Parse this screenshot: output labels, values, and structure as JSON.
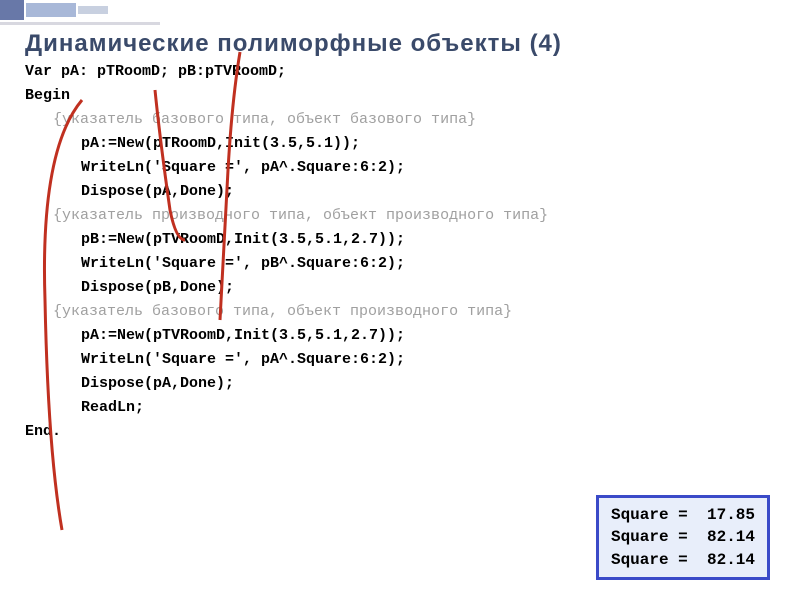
{
  "title": "Динамические полиморфные объекты (4)",
  "code": {
    "l1": "Var pA: pTRoomD; pB:pTVRoomD;",
    "l2": "Begin",
    "c1": "{указатель базового типа, объект базового типа}",
    "l3": "pA:=New(pTRoomD,Init(3.5,5.1));",
    "l4": "WriteLn('Square =', pA^.Square:6:2);",
    "l5": "Dispose(pA,Done);",
    "c2": "{указатель производного типа, объект производного типа}",
    "l6": "pB:=New(pTVRoomD,Init(3.5,5.1,2.7));",
    "l7": "WriteLn('Square =', pB^.Square:6:2);",
    "l8": "Dispose(pB,Done);",
    "c3": "{указатель базового типа, объект производного типа}",
    "l9": "pA:=New(pTVRoomD,Init(3.5,5.1,2.7));",
    "l10": "WriteLn('Square =', pA^.Square:6:2);",
    "l11": "Dispose(pA,Done);",
    "l12": "ReadLn;",
    "l13": "End."
  },
  "output": {
    "line1": "Square =  17.85",
    "line2": "Square =  82.14",
    "line3": "Square =  82.14"
  }
}
